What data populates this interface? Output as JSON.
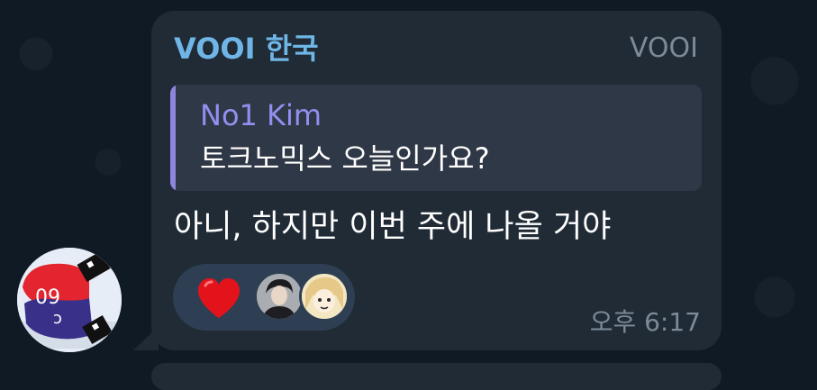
{
  "message": {
    "sender": "VOOI 한국",
    "admin_tag": "VOOI",
    "reply": {
      "author": "No1 Kim",
      "text": "토크노믹스 오늘인가요?"
    },
    "text": "아니, 하지만 이번 주에 나올 거야",
    "time": "오후 6:17",
    "reactions": [
      {
        "emoji": "heart-icon",
        "color": "#e3131c"
      }
    ]
  },
  "colors": {
    "background": "#0f1a24",
    "bubble": "#202b36",
    "sender": "#6fb6e6",
    "reply_accent": "#8d86dc",
    "reaction_pill": "#2e3f53"
  }
}
